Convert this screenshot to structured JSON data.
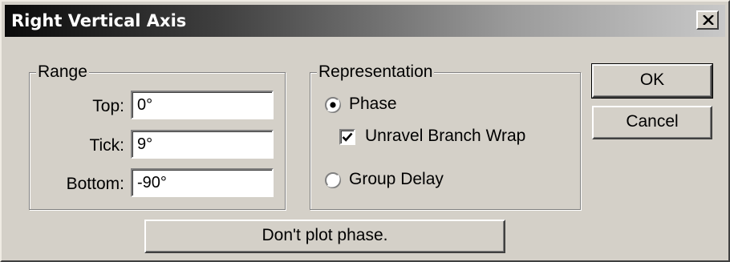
{
  "window": {
    "title": "Right Vertical Axis",
    "close_icon": "close-icon"
  },
  "range": {
    "legend": "Range",
    "top_label": "Top:",
    "top_value": "0°",
    "tick_label": "Tick:",
    "tick_value": "9°",
    "bottom_label": "Bottom:",
    "bottom_value": "-90°"
  },
  "representation": {
    "legend": "Representation",
    "phase_label": "Phase",
    "phase_selected": true,
    "unravel_label": "Unravel Branch Wrap",
    "unravel_checked": true,
    "group_delay_label": "Group Delay",
    "group_delay_selected": false
  },
  "buttons": {
    "ok_label": "OK",
    "cancel_label": "Cancel",
    "no_phase_label": "Don't plot phase."
  }
}
